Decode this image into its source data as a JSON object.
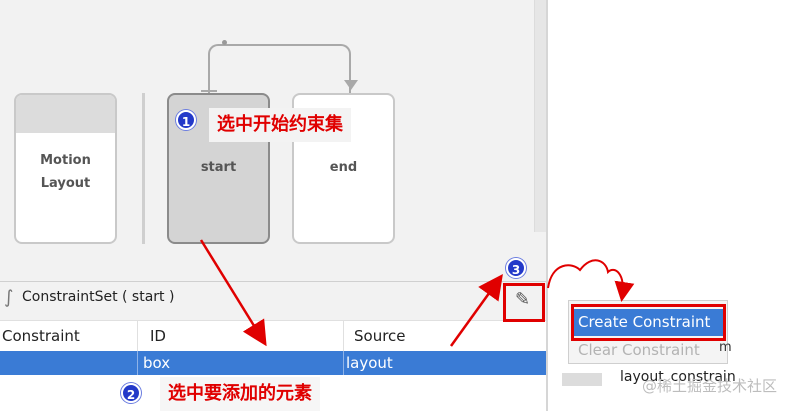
{
  "nodes": {
    "motion_layout": "Motion\nLayout",
    "start": "start",
    "end": "end"
  },
  "constraint_set": {
    "label": "ConstraintSet ( start )",
    "icon": "constraint-set-icon",
    "edit_icon": "pencil-icon"
  },
  "table": {
    "headers": [
      "Constraint",
      "ID",
      "Source"
    ],
    "selected_row": [
      "",
      "box",
      "layout"
    ]
  },
  "popup_menu": {
    "create": "Create Constraint",
    "clear": "Clear Constraint",
    "partial_right": "m",
    "row_text": "layout_constrain"
  },
  "annotations": {
    "step1_number": "1",
    "step1_text": "选中开始约束集",
    "step2_number": "2",
    "step2_text": "选中要添加的元素",
    "step3_number": "3"
  },
  "watermark": "@稀土掘金技术社区",
  "colors": {
    "selection": "#3a7bd5",
    "annotation_red": "#e00000",
    "badge_blue": "#2339c9"
  }
}
